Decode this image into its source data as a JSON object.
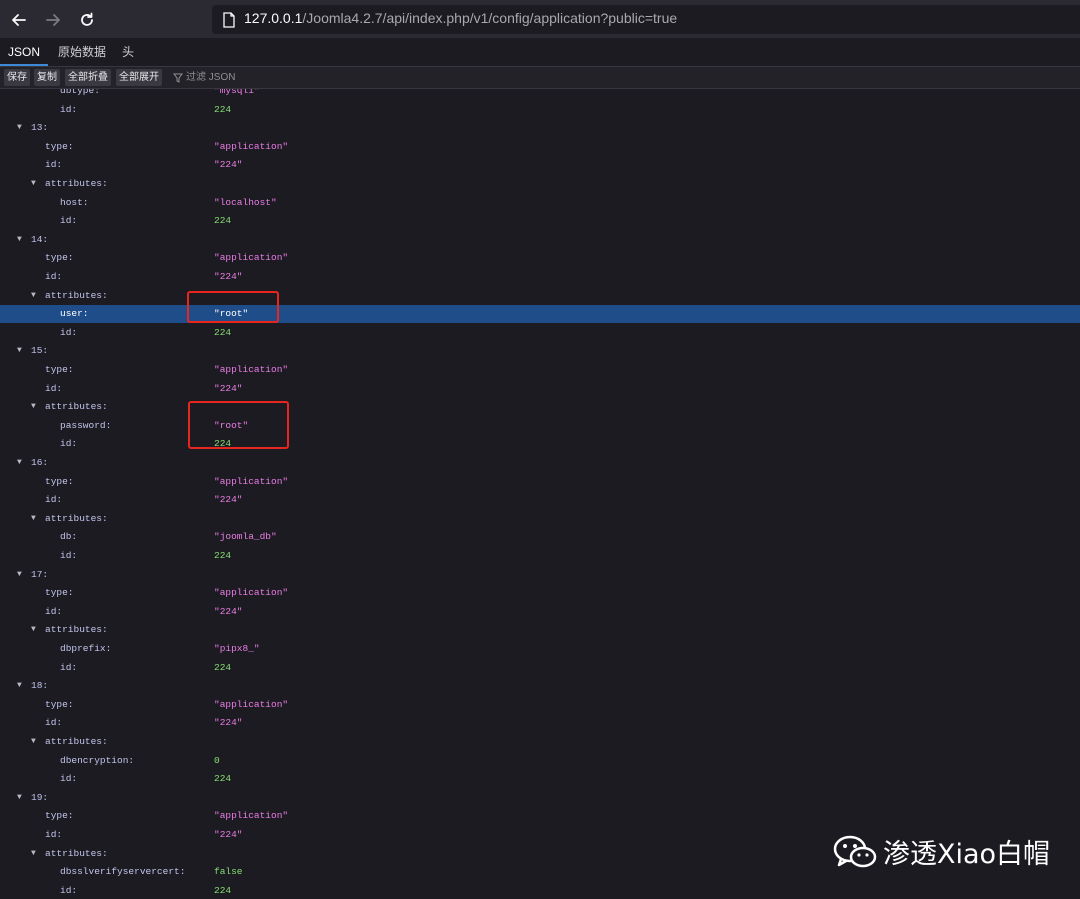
{
  "browser": {
    "url_host": "127.0.0.1",
    "url_path": "/Joomla4.2.7/api/index.php/v1/config/application?public=true"
  },
  "tabs": [
    {
      "label": "JSON",
      "active": true
    },
    {
      "label": "原始数据",
      "active": false
    },
    {
      "label": "头",
      "active": false
    }
  ],
  "toolbar": {
    "save": "保存",
    "copy": "复制",
    "collapse_all": "全部折叠",
    "expand_all": "全部展开",
    "filter_placeholder": "过滤 JSON"
  },
  "json_rows": [
    {
      "indent": 3,
      "key": "dbtype:",
      "value": "\"mysqli\"",
      "vtype": "str"
    },
    {
      "indent": 3,
      "key": "id:",
      "value": "224",
      "vtype": "num"
    },
    {
      "indent": 1,
      "key": "13:",
      "toggle": true
    },
    {
      "indent": 2,
      "key": "type:",
      "value": "\"application\"",
      "vtype": "str"
    },
    {
      "indent": 2,
      "key": "id:",
      "value": "\"224\"",
      "vtype": "str"
    },
    {
      "indent": 2,
      "key": "attributes:",
      "toggle": true
    },
    {
      "indent": 3,
      "key": "host:",
      "value": "\"localhost\"",
      "vtype": "str"
    },
    {
      "indent": 3,
      "key": "id:",
      "value": "224",
      "vtype": "num"
    },
    {
      "indent": 1,
      "key": "14:",
      "toggle": true
    },
    {
      "indent": 2,
      "key": "type:",
      "value": "\"application\"",
      "vtype": "str"
    },
    {
      "indent": 2,
      "key": "id:",
      "value": "\"224\"",
      "vtype": "str"
    },
    {
      "indent": 2,
      "key": "attributes:",
      "toggle": true
    },
    {
      "indent": 3,
      "key": "user:",
      "value": "\"root\"",
      "vtype": "str",
      "selected": true
    },
    {
      "indent": 3,
      "key": "id:",
      "value": "224",
      "vtype": "num"
    },
    {
      "indent": 1,
      "key": "15:",
      "toggle": true
    },
    {
      "indent": 2,
      "key": "type:",
      "value": "\"application\"",
      "vtype": "str"
    },
    {
      "indent": 2,
      "key": "id:",
      "value": "\"224\"",
      "vtype": "str"
    },
    {
      "indent": 2,
      "key": "attributes:",
      "toggle": true
    },
    {
      "indent": 3,
      "key": "password:",
      "value": "\"root\"",
      "vtype": "str"
    },
    {
      "indent": 3,
      "key": "id:",
      "value": "224",
      "vtype": "num"
    },
    {
      "indent": 1,
      "key": "16:",
      "toggle": true
    },
    {
      "indent": 2,
      "key": "type:",
      "value": "\"application\"",
      "vtype": "str"
    },
    {
      "indent": 2,
      "key": "id:",
      "value": "\"224\"",
      "vtype": "str"
    },
    {
      "indent": 2,
      "key": "attributes:",
      "toggle": true
    },
    {
      "indent": 3,
      "key": "db:",
      "value": "\"joomla_db\"",
      "vtype": "str"
    },
    {
      "indent": 3,
      "key": "id:",
      "value": "224",
      "vtype": "num"
    },
    {
      "indent": 1,
      "key": "17:",
      "toggle": true
    },
    {
      "indent": 2,
      "key": "type:",
      "value": "\"application\"",
      "vtype": "str"
    },
    {
      "indent": 2,
      "key": "id:",
      "value": "\"224\"",
      "vtype": "str"
    },
    {
      "indent": 2,
      "key": "attributes:",
      "toggle": true
    },
    {
      "indent": 3,
      "key": "dbprefix:",
      "value": "\"pipx8_\"",
      "vtype": "str"
    },
    {
      "indent": 3,
      "key": "id:",
      "value": "224",
      "vtype": "num"
    },
    {
      "indent": 1,
      "key": "18:",
      "toggle": true
    },
    {
      "indent": 2,
      "key": "type:",
      "value": "\"application\"",
      "vtype": "str"
    },
    {
      "indent": 2,
      "key": "id:",
      "value": "\"224\"",
      "vtype": "str"
    },
    {
      "indent": 2,
      "key": "attributes:",
      "toggle": true
    },
    {
      "indent": 3,
      "key": "dbencryption:",
      "value": "0",
      "vtype": "num"
    },
    {
      "indent": 3,
      "key": "id:",
      "value": "224",
      "vtype": "num"
    },
    {
      "indent": 1,
      "key": "19:",
      "toggle": true
    },
    {
      "indent": 2,
      "key": "type:",
      "value": "\"application\"",
      "vtype": "str"
    },
    {
      "indent": 2,
      "key": "id:",
      "value": "\"224\"",
      "vtype": "str"
    },
    {
      "indent": 2,
      "key": "attributes:",
      "toggle": true
    },
    {
      "indent": 3,
      "key": "dbsslverifyservercert:",
      "value": "false",
      "vtype": "bool"
    },
    {
      "indent": 3,
      "key": "id:",
      "value": "224",
      "vtype": "num"
    }
  ],
  "watermark": {
    "text": "渗透Xiao白帽"
  }
}
